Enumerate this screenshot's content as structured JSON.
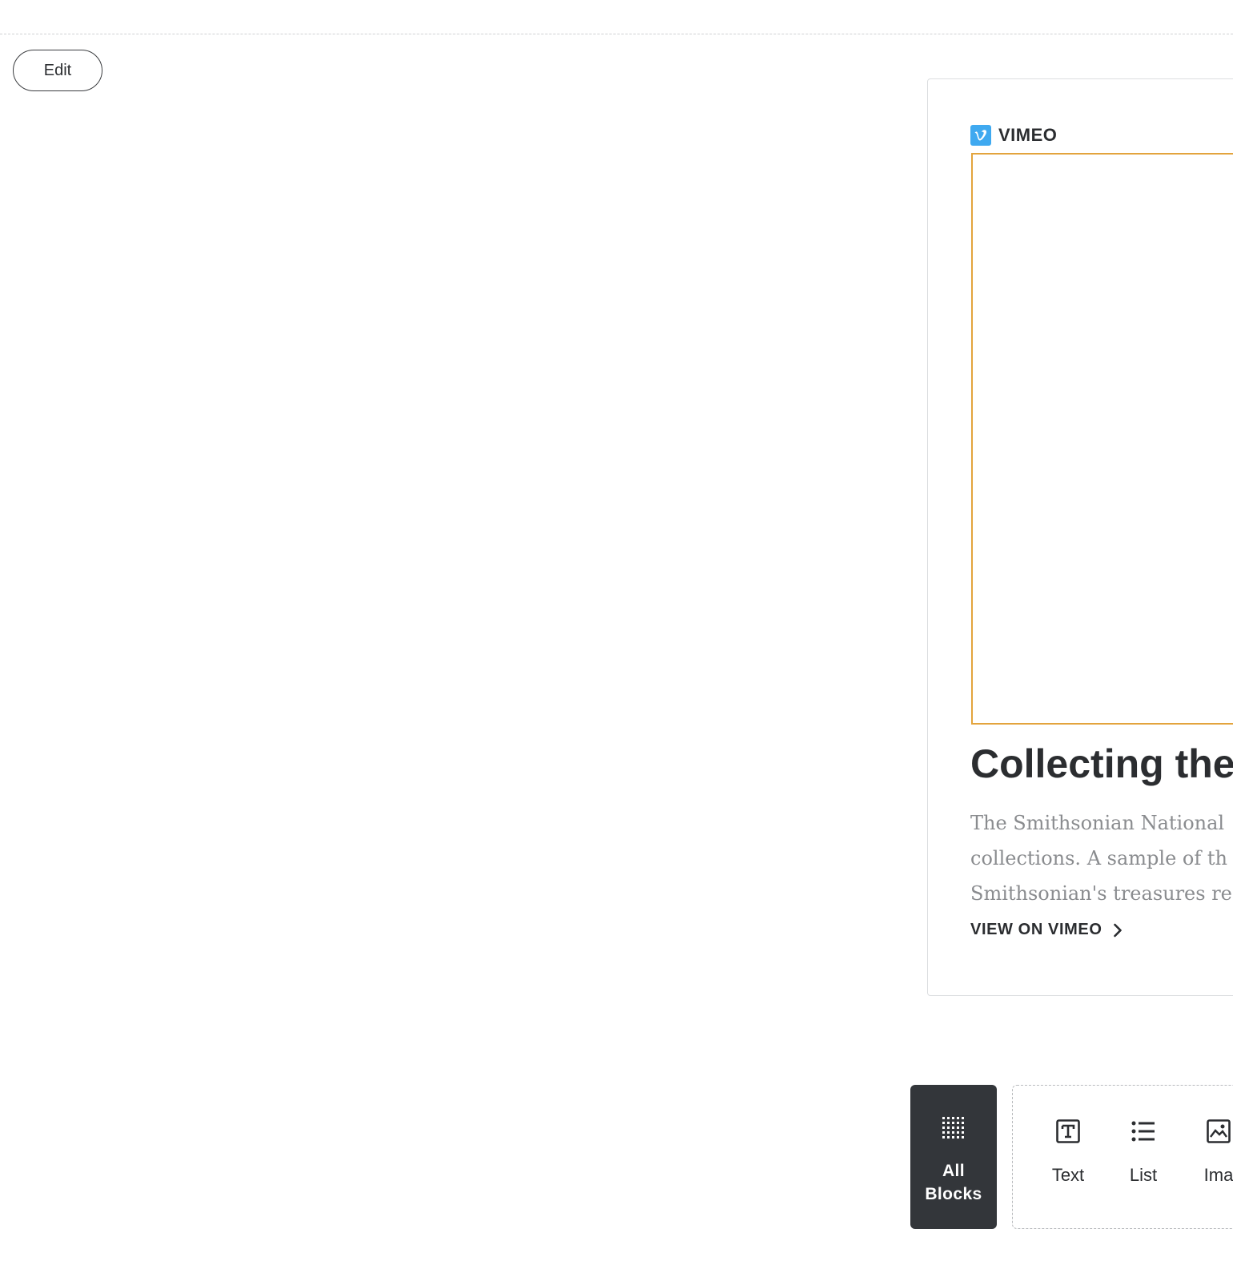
{
  "toolbar": {
    "edit_label": "Edit"
  },
  "embed": {
    "provider": "VIMEO",
    "provider_icon": "vimeo-logo-icon",
    "provider_color": "#3fa9f0",
    "frame_border_color": "#e3a43d",
    "title": "Collecting the",
    "description_lines": [
      "The Smithsonian National",
      "collections. A sample of th",
      "Smithsonian's treasures re"
    ],
    "link_label": "VIEW ON VIMEO",
    "link_icon": "chevron-right-icon"
  },
  "block_picker": {
    "all_blocks": {
      "line1": "All",
      "line2": "Blocks",
      "icon": "grid-icon",
      "background": "#33363a"
    },
    "items": [
      {
        "label": "Text",
        "icon": "text-icon"
      },
      {
        "label": "List",
        "icon": "list-icon"
      },
      {
        "label": "Ima",
        "icon": "image-icon"
      }
    ]
  }
}
